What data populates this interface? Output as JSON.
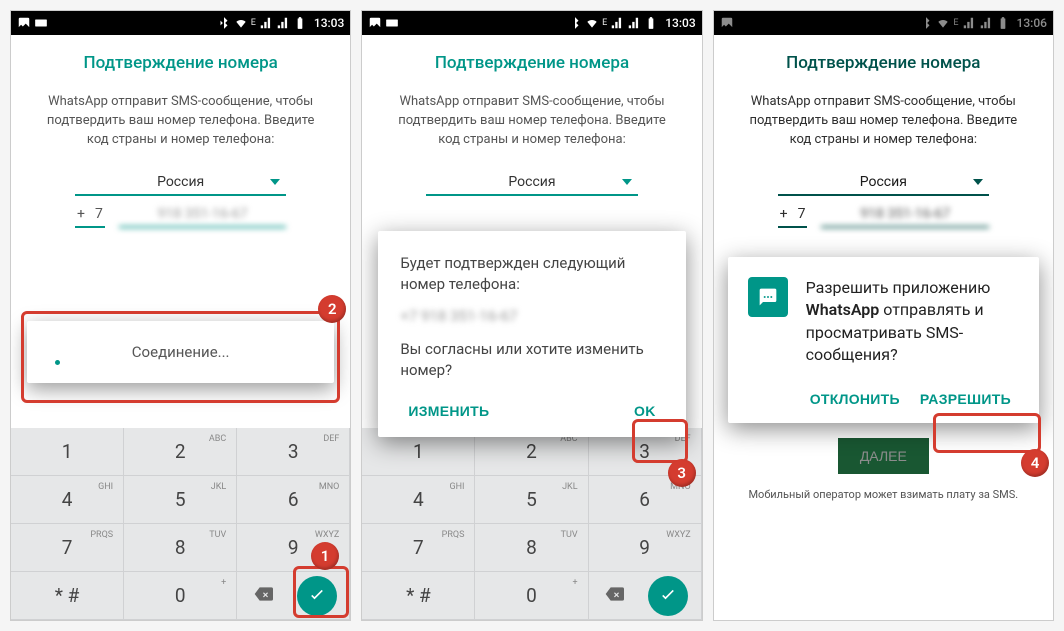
{
  "status": {
    "time1": "13:03",
    "time2": "13:03",
    "time3": "13:06",
    "net": "E"
  },
  "verify": {
    "title": "Подтверждение номера",
    "text": "WhatsApp отправит SMS-сообщение, чтобы подтвердить ваш номер телефона. Введите код страны и номер телефона:",
    "country": "Россия",
    "plus": "+",
    "cc": "7",
    "phone_masked": "918 351-16-67",
    "next": "ДАЛЕЕ",
    "sms_note": "Мобильный оператор может взимать плату за SMS."
  },
  "keypad": {
    "keys": [
      {
        "d": "1",
        "l": ""
      },
      {
        "d": "2",
        "l": "ABC"
      },
      {
        "d": "3",
        "l": "DEF"
      },
      {
        "d": "4",
        "l": "GHI"
      },
      {
        "d": "5",
        "l": "JKL"
      },
      {
        "d": "6",
        "l": "MNO"
      },
      {
        "d": "7",
        "l": "PRQS"
      },
      {
        "d": "8",
        "l": "TUV"
      },
      {
        "d": "9",
        "l": "WXYZ"
      },
      {
        "d": "* #",
        "l": ""
      },
      {
        "d": "0",
        "l": "+"
      }
    ]
  },
  "toast": {
    "text": "Соединение..."
  },
  "confirm": {
    "line1": "Будет подтвержден следующий номер телефона:",
    "number": "+7 918 351-16-67",
    "line2": "Вы согласны или хотите изменить номер?",
    "change": "ИЗМЕНИТЬ",
    "ok": "OK"
  },
  "perm": {
    "pre": "Разрешить приложению ",
    "app": "WhatsApp",
    "post": " отправлять и просматривать SMS-сообщения?",
    "deny": "ОТКЛОНИТЬ",
    "allow": "РАЗРЕШИТЬ"
  },
  "badges": {
    "b1": "1",
    "b2": "2",
    "b3": "3",
    "b4": "4"
  }
}
